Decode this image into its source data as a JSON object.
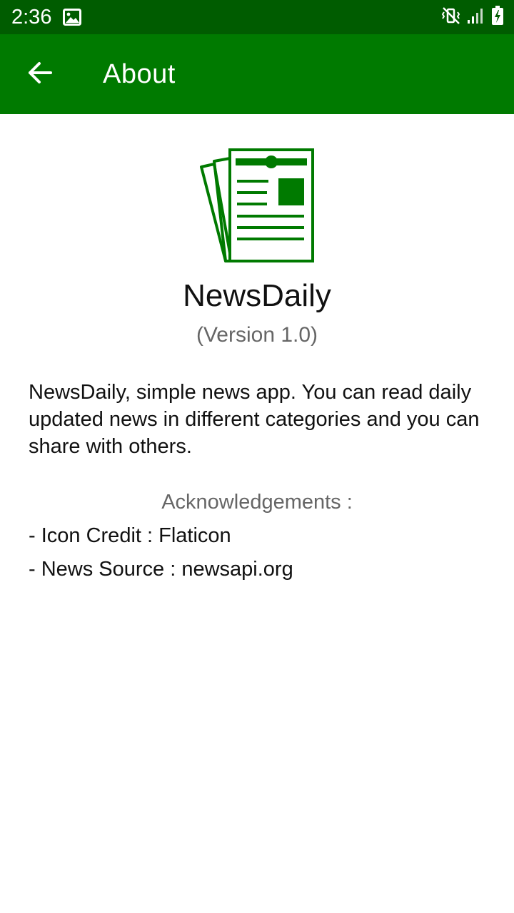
{
  "status_bar": {
    "time": "2:36",
    "icons": [
      "image-icon",
      "mute-vibrate-icon",
      "signal-icon",
      "battery-charging-icon"
    ]
  },
  "app_bar": {
    "back_icon": "arrow-left-icon",
    "title": "About"
  },
  "about": {
    "logo_icon": "newspaper-icon",
    "app_name": "NewsDaily",
    "version": "(Version 1.0)",
    "description": "NewsDaily, simple news app. You can read daily updated news in different categories and you can share with others.",
    "acknowledgements_heading": "Acknowledgements :",
    "acknowledgements": [
      "- Icon Credit : Flaticon",
      "- News Source : newsapi.org"
    ]
  },
  "colors": {
    "status_bar": "#005c00",
    "app_bar": "#007a00",
    "logo": "#007a00",
    "primary_text": "#111111",
    "secondary_text": "#666666"
  }
}
